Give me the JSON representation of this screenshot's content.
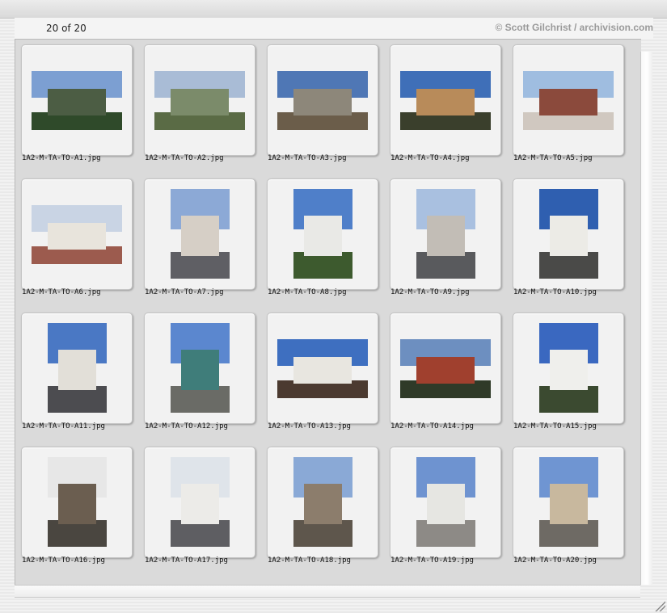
{
  "header": {
    "count_label": "20 of 20",
    "credit": "© Scott Gilchrist / archivision.com"
  },
  "thumbnails": [
    {
      "filename": "1A2-M-TA-TO-A1.jpg",
      "orientation": "landscape",
      "sky": "#7c9fd2",
      "ground": "#2f4a2a",
      "mid": "#4c5d44"
    },
    {
      "filename": "1A2-M-TA-TO-A2.jpg",
      "orientation": "landscape",
      "sky": "#a9bcd6",
      "ground": "#5a6b45",
      "mid": "#7b8b6a"
    },
    {
      "filename": "1A2-M-TA-TO-A3.jpg",
      "orientation": "landscape",
      "sky": "#4f77b5",
      "ground": "#6b5d4a",
      "mid": "#8d877a"
    },
    {
      "filename": "1A2-M-TA-TO-A4.jpg",
      "orientation": "landscape",
      "sky": "#3f6fb8",
      "ground": "#3a3f2c",
      "mid": "#b88b5a"
    },
    {
      "filename": "1A2-M-TA-TO-A5.jpg",
      "orientation": "landscape",
      "sky": "#9fbde0",
      "ground": "#d0c8c0",
      "mid": "#8b4a3c"
    },
    {
      "filename": "1A2-M-TA-TO-A6.jpg",
      "orientation": "landscape",
      "sky": "#c9d4e4",
      "ground": "#9c5b4e",
      "mid": "#e8e4dc"
    },
    {
      "filename": "1A2-M-TA-TO-A7.jpg",
      "orientation": "portrait",
      "sky": "#8ca9d6",
      "ground": "#5f5f64",
      "mid": "#d6cfc6"
    },
    {
      "filename": "1A2-M-TA-TO-A8.jpg",
      "orientation": "portrait",
      "sky": "#4f7fc9",
      "ground": "#3d5a2e",
      "mid": "#e9e9e6"
    },
    {
      "filename": "1A2-M-TA-TO-A9.jpg",
      "orientation": "portrait",
      "sky": "#a9c0e0",
      "ground": "#595a5d",
      "mid": "#c2bdb6"
    },
    {
      "filename": "1A2-M-TA-TO-A10.jpg",
      "orientation": "portrait",
      "sky": "#2f5fb0",
      "ground": "#4a4a48",
      "mid": "#ecebe6"
    },
    {
      "filename": "1A2-M-TA-TO-A11.jpg",
      "orientation": "portrait",
      "sky": "#4a78c4",
      "ground": "#4c4c50",
      "mid": "#e2dfd8"
    },
    {
      "filename": "1A2-M-TA-TO-A12.jpg",
      "orientation": "portrait",
      "sky": "#5b87cf",
      "ground": "#6a6b66",
      "mid": "#3f7d7a"
    },
    {
      "filename": "1A2-M-TA-TO-A13.jpg",
      "orientation": "landscape",
      "sky": "#3e6fc0",
      "ground": "#4b3a30",
      "mid": "#e8e6e0"
    },
    {
      "filename": "1A2-M-TA-TO-A14.jpg",
      "orientation": "landscape",
      "sky": "#6d8fc0",
      "ground": "#2f3a28",
      "mid": "#a0402e"
    },
    {
      "filename": "1A2-M-TA-TO-A15.jpg",
      "orientation": "portrait",
      "sky": "#3a68c0",
      "ground": "#3b4a30",
      "mid": "#efefec"
    },
    {
      "filename": "1A2-M-TA-TO-A16.jpg",
      "orientation": "portrait",
      "sky": "#e7e7e7",
      "ground": "#4a4640",
      "mid": "#6b5e50"
    },
    {
      "filename": "1A2-M-TA-TO-A17.jpg",
      "orientation": "portrait",
      "sky": "#dfe4ea",
      "ground": "#5e5e62",
      "mid": "#ecebe8"
    },
    {
      "filename": "1A2-M-TA-TO-A18.jpg",
      "orientation": "portrait",
      "sky": "#8aa9d6",
      "ground": "#5e564c",
      "mid": "#8c7d6c"
    },
    {
      "filename": "1A2-M-TA-TO-A19.jpg",
      "orientation": "portrait",
      "sky": "#6e93d0",
      "ground": "#8d8a86",
      "mid": "#e6e6e2"
    },
    {
      "filename": "1A2-M-TA-TO-A20.jpg",
      "orientation": "portrait",
      "sky": "#6f95d2",
      "ground": "#6e6a64",
      "mid": "#c8b89e"
    }
  ]
}
